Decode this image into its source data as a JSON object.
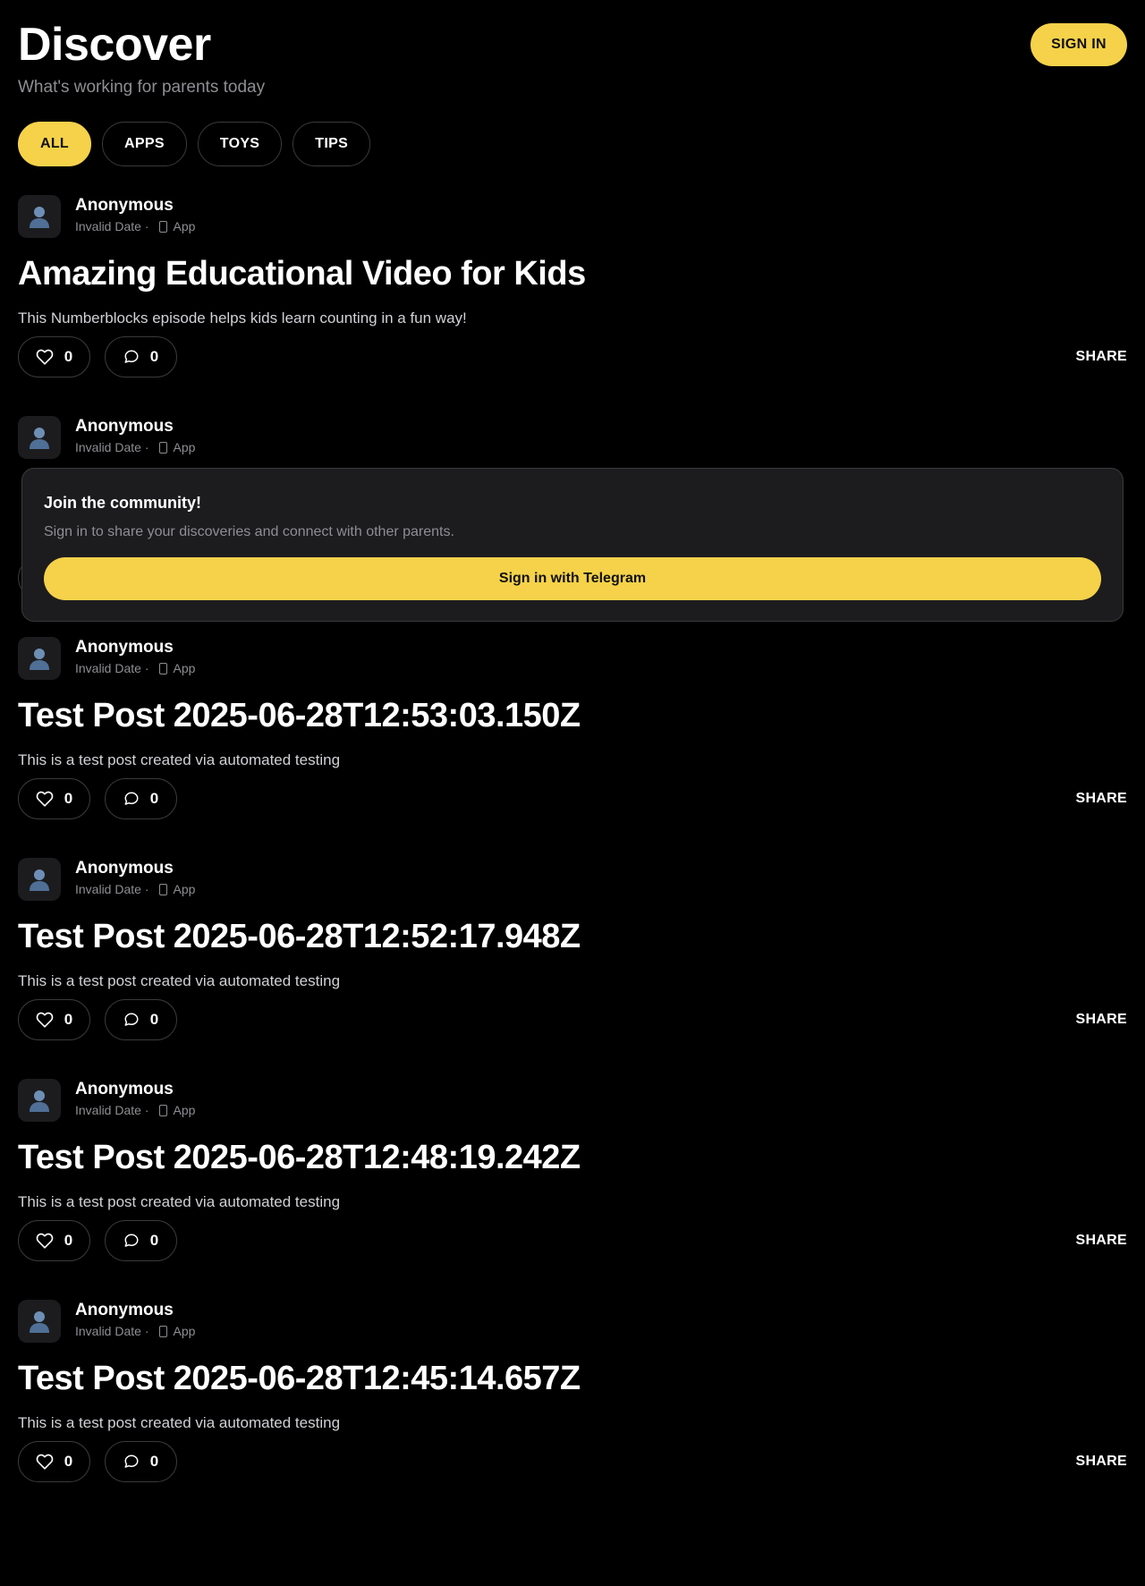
{
  "header": {
    "title": "Discover",
    "subtitle": "What's working for parents today",
    "sign_in_label": "SIGN IN"
  },
  "filters": [
    {
      "label": "ALL",
      "active": true
    },
    {
      "label": "APPS",
      "active": false
    },
    {
      "label": "TOYS",
      "active": false
    },
    {
      "label": "TIPS",
      "active": false
    }
  ],
  "posts": [
    {
      "author": "Anonymous",
      "date": "Invalid Date ·",
      "type": "App",
      "title": "Amazing Educational Video for Kids",
      "body": "This Numberblocks episode helps kids learn counting in a fun way!",
      "likes": "0",
      "comments": "0",
      "share_label": "SHARE"
    },
    {
      "author": "Anonymous",
      "date": "Invalid Date ·",
      "type": "App",
      "title": "",
      "body": "",
      "likes": "",
      "comments": "",
      "share_label": ""
    },
    {
      "author": "Anonymous",
      "date": "Invalid Date ·",
      "type": "App",
      "title": "Test Post 2025-06-28T12:53:03.150Z",
      "body": "This is a test post created via automated testing",
      "likes": "0",
      "comments": "0",
      "share_label": "SHARE"
    },
    {
      "author": "Anonymous",
      "date": "Invalid Date ·",
      "type": "App",
      "title": "Test Post 2025-06-28T12:52:17.948Z",
      "body": "This is a test post created via automated testing",
      "likes": "0",
      "comments": "0",
      "share_label": "SHARE"
    },
    {
      "author": "Anonymous",
      "date": "Invalid Date ·",
      "type": "App",
      "title": "Test Post 2025-06-28T12:48:19.242Z",
      "body": "This is a test post created via automated testing",
      "likes": "0",
      "comments": "0",
      "share_label": "SHARE"
    },
    {
      "author": "Anonymous",
      "date": "Invalid Date ·",
      "type": "App",
      "title": "Test Post 2025-06-28T12:45:14.657Z",
      "body": "This is a test post created via automated testing",
      "likes": "0",
      "comments": "0",
      "share_label": "SHARE"
    }
  ],
  "join_card": {
    "title": "Join the community!",
    "text": "Sign in to share your discoveries and connect with other parents.",
    "button_label": "Sign in with Telegram"
  },
  "icons": {
    "avatar": "user-icon",
    "type": "phone-icon",
    "like": "heart-icon",
    "comment": "comment-icon"
  },
  "colors": {
    "accent": "#f5d24a",
    "background": "#000000",
    "card": "#1c1c1e",
    "muted": "#8e8e93"
  }
}
